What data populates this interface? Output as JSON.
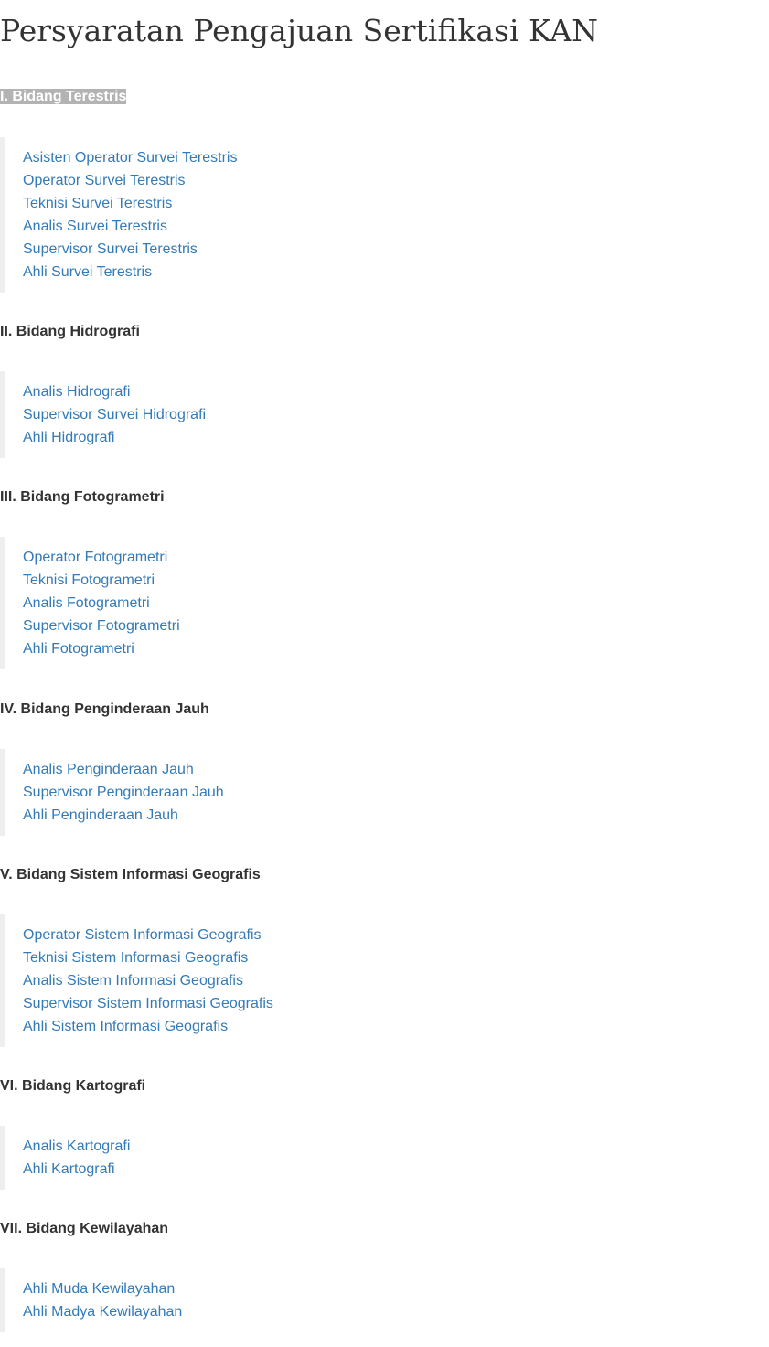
{
  "page": {
    "title": "Persyaratan Pengajuan Sertifikasi KAN"
  },
  "colors": {
    "text": "#333333",
    "link": "#337ab7",
    "highlight_bg": "#b3b3b3",
    "blockquote_border": "#eeeeee"
  },
  "sections": [
    {
      "heading": "I. Bidang Terestris",
      "highlighted": true,
      "links": [
        "Asisten Operator Survei Terestris",
        "Operator Survei Terestris",
        "Teknisi Survei Terestris",
        "Analis Survei Terestris",
        "Supervisor Survei Terestris",
        "Ahli Survei Terestris"
      ]
    },
    {
      "heading": "II. Bidang Hidrografi",
      "highlighted": false,
      "links": [
        "Analis Hidrografi",
        "Supervisor Survei Hidrografi",
        "Ahli Hidrografi"
      ]
    },
    {
      "heading": "III. Bidang Fotogrametri",
      "highlighted": false,
      "links": [
        "Operator Fotogrametri",
        "Teknisi Fotogrametri",
        "Analis Fotogrametri",
        "Supervisor Fotogrametri",
        "Ahli Fotogrametri"
      ]
    },
    {
      "heading": "IV. Bidang Penginderaan Jauh",
      "highlighted": false,
      "links": [
        "Analis Penginderaan Jauh",
        "Supervisor Penginderaan Jauh",
        "Ahli Penginderaan Jauh"
      ]
    },
    {
      "heading": "V. Bidang Sistem Informasi Geografis",
      "highlighted": false,
      "links": [
        "Operator Sistem Informasi Geografis",
        "Teknisi Sistem Informasi Geografis",
        "Analis Sistem Informasi Geografis",
        "Supervisor Sistem Informasi Geografis",
        "Ahli Sistem Informasi Geografis"
      ]
    },
    {
      "heading": "VI. Bidang Kartografi",
      "highlighted": false,
      "links": [
        "Analis Kartografi",
        "Ahli Kartografi"
      ]
    },
    {
      "heading": "VII. Bidang Kewilayahan",
      "highlighted": false,
      "links": [
        "Ahli Muda Kewilayahan",
        "Ahli Madya Kewilayahan"
      ]
    }
  ]
}
